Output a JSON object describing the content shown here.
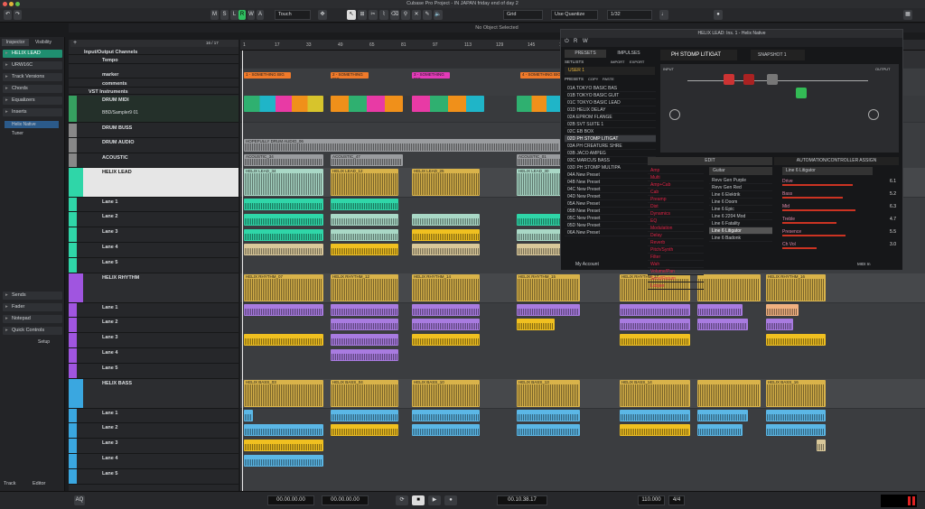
{
  "window": {
    "title": "Cubase Pro Project - IN JAPAN friday end of day 2",
    "status": "No Object Selected"
  },
  "toolbar": {
    "m": "M",
    "s": "S",
    "l": "L",
    "r": "R",
    "w": "W",
    "a": "A",
    "automation_mode": "Touch",
    "grid_type": "Grid",
    "quantize": "Use Quantize",
    "quantize_value": "1/32"
  },
  "inspector": {
    "tabs": [
      "Inspector",
      "Visibility"
    ],
    "track_name": "HELIX LEAD",
    "sections": [
      "URW16C",
      "Track Versions",
      "Chords",
      "Equalizers",
      "Inserts"
    ],
    "insert_plugin": "Helix Native",
    "insert_2": "Tuner",
    "bottom_sections": [
      "Sends",
      "Fader",
      "Notepad",
      "Quick Controls"
    ],
    "setup": "Setup",
    "bottom_tabs": [
      "Track",
      "Editor"
    ]
  },
  "tracklist": {
    "counter": "16 / 17",
    "tracks": [
      {
        "name": "Input/Output Channels"
      },
      {
        "name": "Tempo"
      },
      {
        "name": "marker"
      },
      {
        "name": "comments"
      },
      {
        "name": "VST Instruments"
      },
      {
        "name": "DRUM MIDI"
      },
      {
        "name": "BBD/Sampler9 01"
      },
      {
        "name": "DRUM BUSS"
      },
      {
        "name": "DRUM AUDIO"
      },
      {
        "name": "ACOUSTIC"
      },
      {
        "name": "HELIX LEAD"
      },
      {
        "name": "Lane 1"
      },
      {
        "name": "Lane 2"
      },
      {
        "name": "Lane 3"
      },
      {
        "name": "Lane 4"
      },
      {
        "name": "Lane 5"
      },
      {
        "name": "HELIX RHYTHM"
      },
      {
        "name": "Lane 1"
      },
      {
        "name": "Lane 2"
      },
      {
        "name": "Lane 3"
      },
      {
        "name": "Lane 4"
      },
      {
        "name": "Lane 5"
      },
      {
        "name": "HELIX BASS"
      },
      {
        "name": "Lane 1"
      },
      {
        "name": "Lane 2"
      },
      {
        "name": "Lane 3"
      },
      {
        "name": "Lane 4"
      },
      {
        "name": "Lane 5"
      }
    ]
  },
  "ruler": {
    "bars": [
      "1",
      "17",
      "33",
      "49",
      "65",
      "81",
      "97",
      "113",
      "129",
      "145",
      "161"
    ]
  },
  "clips": {
    "drum_audio": "HOPEFULLY DRUM AUDIO_06",
    "acoustic_a": "ACOUSTIC_34",
    "acoustic_b": "ACOUSTIC_47",
    "acoustic_c": "ACOUSTIC_01",
    "lead_a": "HELIX LEAD_34",
    "lead_b": "HELIX LEAD_12",
    "lead_c": "HELIX LEAD_25",
    "lead_d": "HELIX LEAD_30",
    "rhythm_a": "HELIX RHYTHM_07",
    "rhythm_b": "HELIX RHYTHM_12",
    "rhythm_c": "HELIX RHYTHM_14",
    "rhythm_d": "HELIX RHYTHM_15",
    "rhythm_e": "HELIX RHYTHM_17",
    "rhythm_f": "HELIX RHYTHM_16",
    "bass_a": "HELIX BASS_03",
    "bass_b": "HELIX BASS_04",
    "bass_c": "HELIX BASS_10",
    "bass_d": "HELIX BASS_13",
    "bass_e": "HELIX BASS_14",
    "bass_f": "HELIX BASS_16",
    "marker1": "1 - SOMETHING BIG",
    "marker2": "2 - SOMETHING BIG",
    "marker3": "3 - SOMETHING BIG",
    "marker4": "4 - SOMETHING BIG"
  },
  "plugin": {
    "title": "HELIX LEAD: Ins. 1 - Helix Native",
    "tabs": [
      "PRESETS",
      "IMPULSES"
    ],
    "setlist_label": "SETLISTS",
    "import": "IMPORT",
    "export": "EXPORT",
    "user": "USER 1",
    "presets_label": "PRESETS",
    "copy": "COPY",
    "paste": "PASTE",
    "preset_name": "PH STOMP LITIGAT",
    "snapshot": "SNAPSHOT 1",
    "presets": [
      "01A TOKYO BASIC BAS",
      "01B TOKYO BASIC GUIT",
      "01C TOKYO BASIC LEAD",
      "01D HELIX DELAY",
      "02A EPROM FLANGE",
      "02B SVT SUITE 1",
      "02C EB BOX",
      "02D PH STOMP LITIGAT",
      "03A PH CREATURE SHRE",
      "03B JACO AMPEG",
      "03C MARCUS BASS",
      "03D PH STOMP MULTIPA",
      "04A New Preset",
      "04B New Preset",
      "04C New Preset",
      "04D New Preset",
      "05A New Preset",
      "05B New Preset",
      "05C New Preset",
      "05D New Preset",
      "06A New Preset"
    ],
    "account": "My Account",
    "edit_tab": "EDIT",
    "automation_tab": "AUTOMATION/CONTROLLER ASSIGN",
    "categories": [
      "Amp",
      "Multi",
      "Amp+Cab",
      "Cab",
      "Preamp",
      "Dist",
      "Dynamics",
      "EQ",
      "Modulation",
      "Delay",
      "Reverb",
      "Pitch/Synth",
      "Filter",
      "Wah",
      "Volume/Pan",
      "Send/Return",
      "Looper"
    ],
    "amp_type": "Guitar",
    "amps": [
      "Revv Gen Purple",
      "Revv Gen Red",
      "Line 6 Elektrik",
      "Line 6 Doom",
      "Line 6 Epic",
      "Line 6 2204 Mod",
      "Line 6 Fatality",
      "Line 6 Litigator",
      "Line 6 Badonk"
    ],
    "selected_amp": "Line 6 Litigator",
    "params": [
      {
        "name": "Drive",
        "value": "6.1"
      },
      {
        "name": "Bass",
        "value": "5.2"
      },
      {
        "name": "Mid",
        "value": "6.3"
      },
      {
        "name": "Treble",
        "value": "4.7"
      },
      {
        "name": "Presence",
        "value": "5.5"
      },
      {
        "name": "Ch Vol",
        "value": "3.0"
      }
    ],
    "midi_in": "MIDI In",
    "input": "INPUT",
    "output": "OUTPUT"
  },
  "transport": {
    "left_locator": "00.00.00.00",
    "right_locator": "00.00.00.00",
    "position": "00.10.38.17",
    "tempo": "110.000",
    "signature": "4/4",
    "aq": "AQ"
  },
  "colors": {
    "lead": "#2fd6a8",
    "rhythm": "#a055e0",
    "bass": "#3aa7e0",
    "gold": "#d9b34a",
    "yellow": "#f0c020",
    "blue_clip": "#5bb7e6",
    "purple_clip": "#a87be0"
  }
}
